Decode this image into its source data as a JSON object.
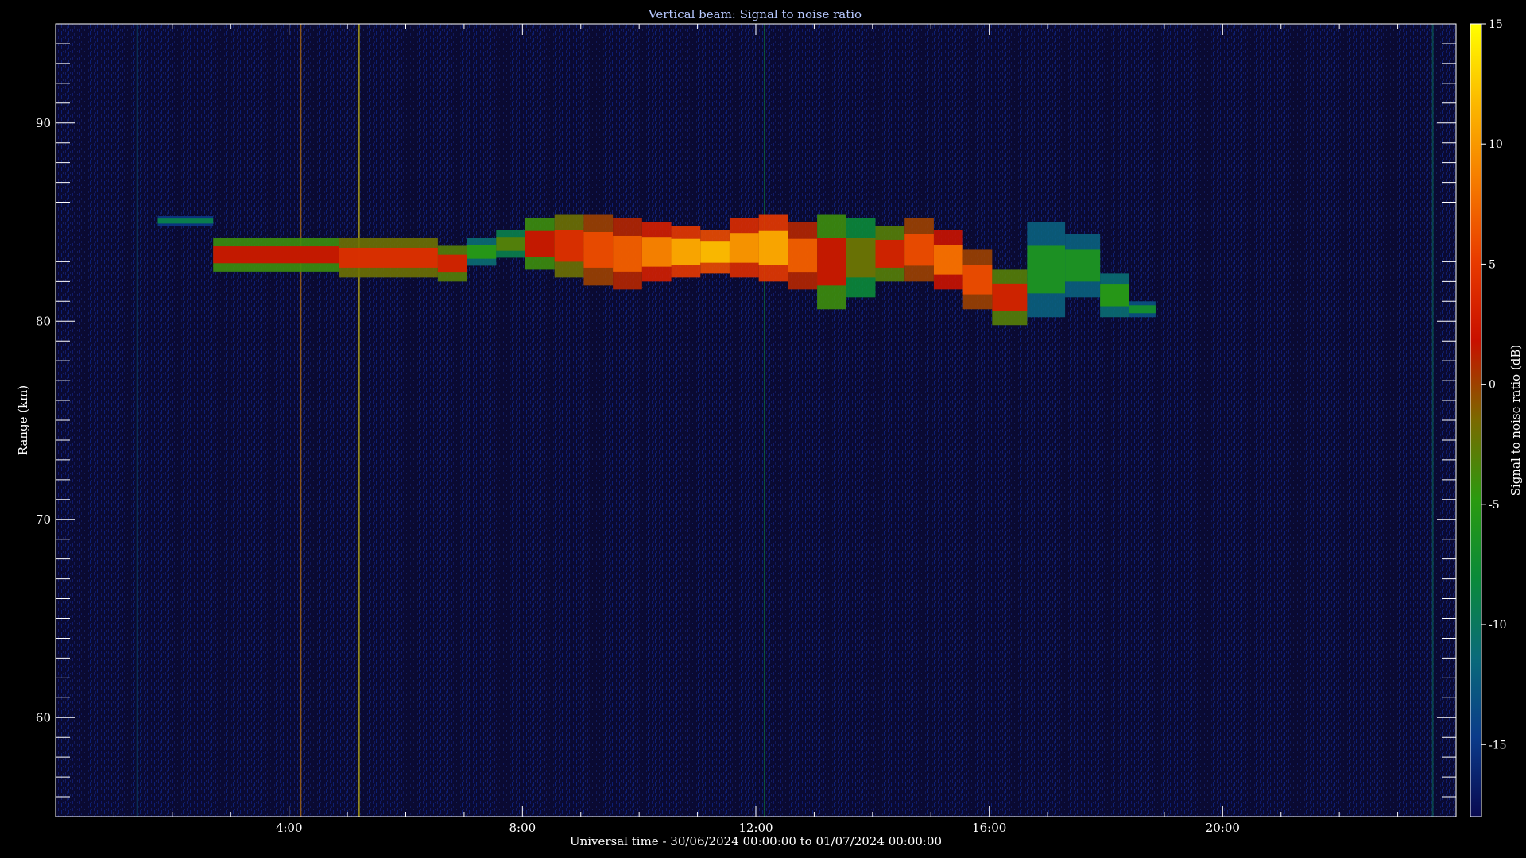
{
  "chart_data": {
    "type": "heatmap",
    "title": "Vertical beam: Signal to noise ratio",
    "xlabel": "Universal time - 30/06/2024 00:00:00 to 01/07/2024 00:00:00",
    "ylabel": "Range (km)",
    "x_unit": "hours UT",
    "xlim": [
      0,
      24
    ],
    "ylim": [
      55,
      95
    ],
    "x_ticks": [
      {
        "value": 4,
        "label": "4:00"
      },
      {
        "value": 8,
        "label": "8:00"
      },
      {
        "value": 12,
        "label": "12:00"
      },
      {
        "value": 16,
        "label": "16:00"
      },
      {
        "value": 20,
        "label": "20:00"
      }
    ],
    "y_ticks": [
      {
        "value": 60,
        "label": "60"
      },
      {
        "value": 70,
        "label": "70"
      },
      {
        "value": 80,
        "label": "80"
      },
      {
        "value": 90,
        "label": "90"
      }
    ],
    "colorbar": {
      "label": "Signal to noise ratio (dB)",
      "range": [
        -18,
        15
      ],
      "ticks": [
        {
          "value": 15,
          "label": "15"
        },
        {
          "value": 10,
          "label": "10"
        },
        {
          "value": 5,
          "label": "5"
        },
        {
          "value": 0,
          "label": "0"
        },
        {
          "value": -5,
          "label": "-5"
        },
        {
          "value": -10,
          "label": "-10"
        },
        {
          "value": -15,
          "label": "-15"
        }
      ],
      "colormap": [
        "#0a0a50",
        "#0b3b8a",
        "#0a6a7a",
        "#0a8a3a",
        "#2a9a10",
        "#7a6a00",
        "#c81000",
        "#e83a00",
        "#f57a00",
        "#fbb800",
        "#ffff00"
      ]
    },
    "background_snr_db": -16,
    "echo_layer": [
      {
        "t": 2.0,
        "bottom": 84.8,
        "top": 85.3,
        "snr": -9
      },
      {
        "t": 3.4,
        "bottom": 82.5,
        "top": 84.2,
        "snr": 2
      },
      {
        "t": 6.3,
        "bottom": 82.2,
        "top": 84.2,
        "snr": 4
      },
      {
        "t": 6.8,
        "bottom": 82.0,
        "top": 83.8,
        "snr": 3
      },
      {
        "t": 7.3,
        "bottom": 82.8,
        "top": 84.2,
        "snr": -5
      },
      {
        "t": 7.8,
        "bottom": 83.2,
        "top": 84.6,
        "snr": -3
      },
      {
        "t": 8.3,
        "bottom": 82.6,
        "top": 85.2,
        "snr": 2
      },
      {
        "t": 8.8,
        "bottom": 82.2,
        "top": 85.4,
        "snr": 4
      },
      {
        "t": 9.3,
        "bottom": 81.8,
        "top": 85.4,
        "snr": 6
      },
      {
        "t": 9.8,
        "bottom": 81.6,
        "top": 85.2,
        "snr": 7
      },
      {
        "t": 10.3,
        "bottom": 82.0,
        "top": 85.0,
        "snr": 9
      },
      {
        "t": 10.8,
        "bottom": 82.2,
        "top": 84.8,
        "snr": 11
      },
      {
        "t": 11.3,
        "bottom": 82.4,
        "top": 84.6,
        "snr": 12
      },
      {
        "t": 11.8,
        "bottom": 82.2,
        "top": 85.2,
        "snr": 10
      },
      {
        "t": 12.3,
        "bottom": 82.0,
        "top": 85.4,
        "snr": 11
      },
      {
        "t": 12.8,
        "bottom": 81.6,
        "top": 85.0,
        "snr": 7
      },
      {
        "t": 13.3,
        "bottom": 80.6,
        "top": 85.4,
        "snr": 2
      },
      {
        "t": 13.8,
        "bottom": 81.2,
        "top": 85.2,
        "snr": -2
      },
      {
        "t": 14.3,
        "bottom": 82.0,
        "top": 84.8,
        "snr": 3
      },
      {
        "t": 14.8,
        "bottom": 82.0,
        "top": 85.2,
        "snr": 6
      },
      {
        "t": 15.3,
        "bottom": 81.6,
        "top": 84.6,
        "snr": 8
      },
      {
        "t": 15.8,
        "bottom": 80.6,
        "top": 83.6,
        "snr": 6
      },
      {
        "t": 16.3,
        "bottom": 79.8,
        "top": 82.6,
        "snr": 3
      },
      {
        "t": 17.0,
        "bottom": 80.2,
        "top": 85.0,
        "snr": -6
      },
      {
        "t": 17.6,
        "bottom": 81.2,
        "top": 84.4,
        "snr": -6
      },
      {
        "t": 18.2,
        "bottom": 80.2,
        "top": 82.4,
        "snr": -5
      },
      {
        "t": 18.6,
        "bottom": 80.2,
        "top": 81.0,
        "snr": -7
      }
    ],
    "vertical_interference": [
      {
        "t": 1.4,
        "snr": -12
      },
      {
        "t": 4.2,
        "snr": 10
      },
      {
        "t": 5.2,
        "snr": 14
      },
      {
        "t": 12.15,
        "snr": -8
      },
      {
        "t": 23.6,
        "snr": -10
      }
    ]
  }
}
